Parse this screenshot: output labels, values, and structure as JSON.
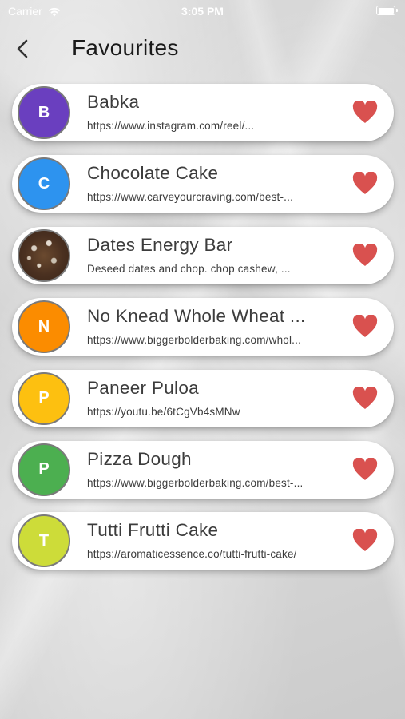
{
  "status_bar": {
    "carrier": "Carrier",
    "time": "3:05 PM"
  },
  "header": {
    "title": "Favourites"
  },
  "colors": {
    "heart": "#d9514f",
    "background": "#d6d6d6"
  },
  "favourites": [
    {
      "initial": "B",
      "color": "#6a3fbf",
      "title": "Babka",
      "subtitle": "https://www.instagram.com/reel/...",
      "has_photo": false
    },
    {
      "initial": "C",
      "color": "#2d93ef",
      "title": "Chocolate Cake",
      "subtitle": "https://www.carveyourcraving.com/best-...",
      "has_photo": false
    },
    {
      "initial": "",
      "color": "#4a3020",
      "title": "Dates Energy Bar",
      "subtitle": "Deseed dates and chop. chop cashew, ...",
      "has_photo": true
    },
    {
      "initial": "N",
      "color": "#fb8c00",
      "title": "No Knead Whole Wheat ...",
      "subtitle": "https://www.biggerbolderbaking.com/whol...",
      "has_photo": false
    },
    {
      "initial": "P",
      "color": "#fdc010",
      "title": "Paneer Puloa",
      "subtitle": "https://youtu.be/6tCgVb4sMNw",
      "has_photo": false
    },
    {
      "initial": "P",
      "color": "#4caf50",
      "title": "Pizza Dough",
      "subtitle": "https://www.biggerbolderbaking.com/best-...",
      "has_photo": false
    },
    {
      "initial": "T",
      "color": "#cddc39",
      "title": "Tutti Frutti Cake",
      "subtitle": "https://aromaticessence.co/tutti-frutti-cake/",
      "has_photo": false
    }
  ]
}
